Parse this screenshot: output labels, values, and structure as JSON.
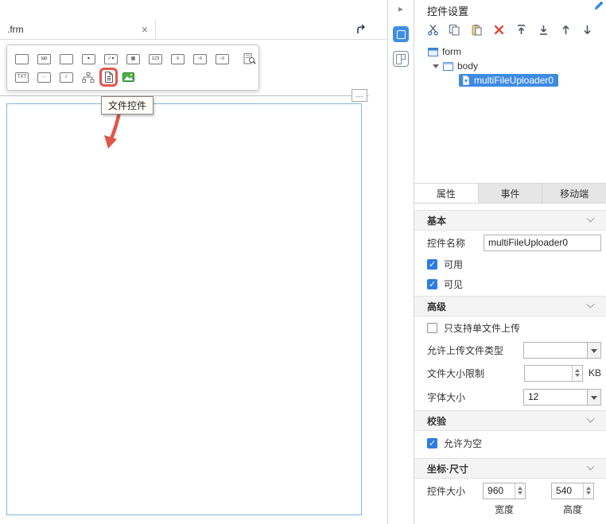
{
  "colors": {
    "accent_blue": "#3e8ee6",
    "selection_blue": "#3d8ae2",
    "highlight_red": "#e2574a",
    "canvas_border": "#7db9dd",
    "delete_red": "#e2382c"
  },
  "left": {
    "tab_title": ".frm",
    "close_glyph": "×",
    "more_glyph": "…",
    "tooltip": "文件控件",
    "palette_glyphs": {
      "label": "lab",
      "dropdown": "▾",
      "check_dropdown": "✓▾",
      "grid": "▦",
      "number": "123",
      "textarea": "≡",
      "radio_group": "◦≡",
      "checkbox_group": "▫≡",
      "text": "TXT",
      "date": "···",
      "checkbox": "✓"
    }
  },
  "icons": {
    "palette_row1": [
      "textbox-icon",
      "label-icon",
      "button-icon",
      "dropdown-icon",
      "check-dropdown-icon",
      "table-icon",
      "number-icon",
      "textarea-icon",
      "radio-group-icon",
      "checkbox-group-icon",
      "query-icon"
    ],
    "palette_row2": [
      "text-icon",
      "date-icon",
      "checkbox-icon",
      "tree-icon",
      "file-icon",
      "image-icon"
    ],
    "panel_toolbar": [
      "cut-icon",
      "copy-icon",
      "paste-icon",
      "delete-icon",
      "move-top-icon",
      "move-bottom-icon",
      "move-up-icon",
      "move-down-icon"
    ],
    "strip": [
      "expand-icon",
      "widget-settings-icon",
      "layout-panel-icon"
    ]
  },
  "strip": {
    "expand_glyph": "▸"
  },
  "panel": {
    "title": "控件设置",
    "tree": [
      {
        "label": "form"
      },
      {
        "label": "body"
      },
      {
        "label": "multiFileUploader0",
        "selected": true
      }
    ],
    "tabs": [
      {
        "label": "属性",
        "active": true
      },
      {
        "label": "事件"
      },
      {
        "label": "移动端"
      }
    ],
    "basic": {
      "header": "基本",
      "name_label": "控件名称",
      "name_value": "multiFileUploader0",
      "enabled_label": "可用",
      "visible_label": "可见"
    },
    "advanced": {
      "header": "高级",
      "single_file_label": "只支持单文件上传",
      "file_types_label": "允许上传文件类型",
      "file_types_value": "",
      "size_limit_label": "文件大小限制",
      "size_limit_value": "",
      "size_unit": "KB",
      "font_size_label": "字体大小",
      "font_size_value": "12"
    },
    "validation": {
      "header": "校验",
      "allow_empty_label": "允许为空"
    },
    "geometry": {
      "header": "坐标·尺寸",
      "size_label": "控件大小",
      "width_value": "960",
      "height_value": "540",
      "width_label": "宽度",
      "height_label": "高度"
    }
  }
}
